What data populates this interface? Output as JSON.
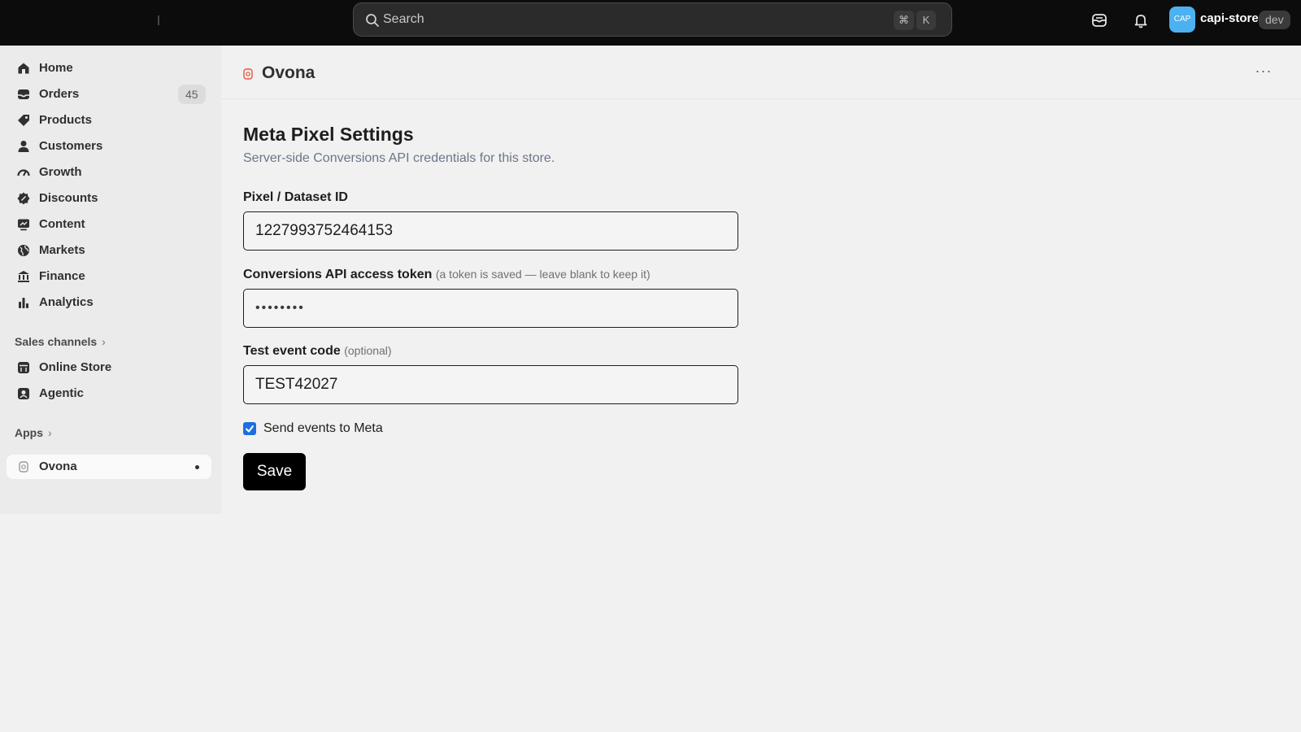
{
  "topbar": {
    "search_placeholder": "Search",
    "shortcut_modifier": "⌘",
    "shortcut_key": "K",
    "store_initials": "CAP",
    "store_name": "capi-store",
    "env_badge": "dev"
  },
  "sidebar": {
    "items": [
      {
        "label": "Home",
        "icon": "home-icon"
      },
      {
        "label": "Orders",
        "icon": "orders-icon",
        "count": "45"
      },
      {
        "label": "Products",
        "icon": "tag-icon"
      },
      {
        "label": "Customers",
        "icon": "person-icon"
      },
      {
        "label": "Growth",
        "icon": "gauge-icon"
      },
      {
        "label": "Discounts",
        "icon": "discount-icon"
      },
      {
        "label": "Content",
        "icon": "content-icon"
      },
      {
        "label": "Markets",
        "icon": "globe-icon"
      },
      {
        "label": "Finance",
        "icon": "bank-icon"
      },
      {
        "label": "Analytics",
        "icon": "bar-chart-icon"
      }
    ],
    "sales_channels_label": "Sales channels",
    "channels": [
      {
        "label": "Online Store",
        "icon": "storefront-icon"
      },
      {
        "label": "Agentic",
        "icon": "agent-icon"
      }
    ],
    "apps_label": "Apps",
    "apps": [
      {
        "label": "Ovona",
        "icon": "ovona-app-icon"
      }
    ]
  },
  "header": {
    "title": "Ovona",
    "more_label": "···"
  },
  "settings": {
    "heading": "Meta Pixel Settings",
    "subtitle": "Server-side Conversions API credentials for this store.",
    "pixel_label": "Pixel / Dataset ID",
    "pixel_value": "1227993752464153",
    "token_label": "Conversions API access token",
    "token_hint": "(a token is saved — leave blank to keep it)",
    "token_value": "••••••••",
    "test_label": "Test event code",
    "test_hint": "(optional)",
    "test_value": "TEST42027",
    "send_events_label": "Send events to Meta",
    "send_events_checked": true,
    "save_label": "Save"
  },
  "colors": {
    "topbar": "#0c0c0c",
    "accent_checkbox": "#1c6fe0",
    "store_avatar": "#4cb1f0",
    "ovona_icon": "#e8553e"
  }
}
